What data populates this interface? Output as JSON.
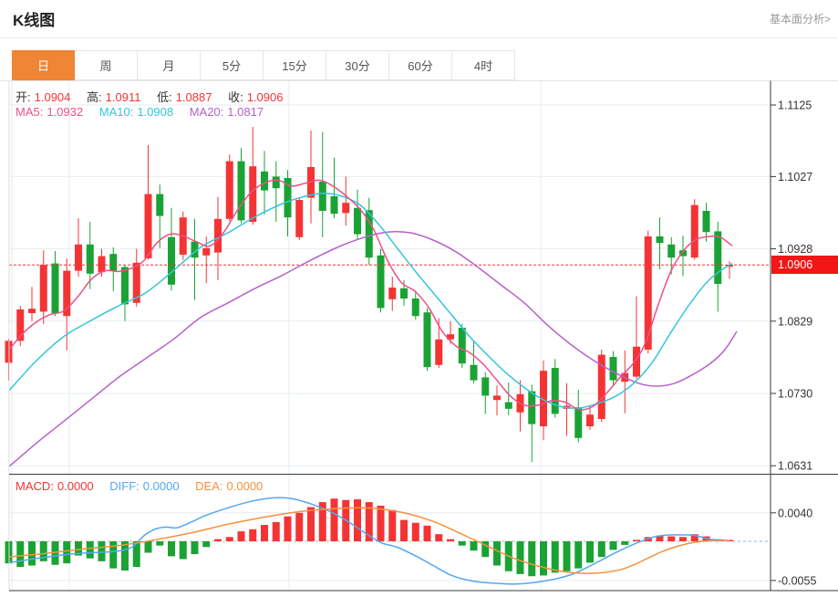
{
  "header": {
    "title": "K线图",
    "link_label": "基本面分析>"
  },
  "tabs": {
    "items": [
      "日",
      "周",
      "月",
      "5分",
      "15分",
      "30分",
      "60分",
      "4时"
    ],
    "active": "日"
  },
  "ohlc": {
    "o_label": "开:",
    "o": "1.0904",
    "h_label": "高:",
    "h": "1.0911",
    "l_label": "低:",
    "l": "1.0887",
    "c_label": "收:",
    "c": "1.0906"
  },
  "ma": {
    "ma5_label": "MA5:",
    "ma5": "1.0932",
    "ma10_label": "MA10:",
    "ma10": "1.0908",
    "ma20_label": "MA20:",
    "ma20": "1.0817"
  },
  "macd_readout": {
    "macd_label": "MACD:",
    "macd": "0.0000",
    "diff_label": "DIFF:",
    "diff": "0.0000",
    "dea_label": "DEA:",
    "dea": "0.0000"
  },
  "price_tag": "1.0906",
  "colors": {
    "up": "#f43434",
    "down": "#1aa334",
    "ma5": "#ee5087",
    "ma10": "#35c5dc",
    "ma20": "#b662c9",
    "diff": "#55a7f0",
    "dea": "#f5913d",
    "tab_active": "#ef8535",
    "tag_bg": "#f21616",
    "axis_text": "#333333",
    "grid": "#e6edf3",
    "frame": "#3a3a3a",
    "light_border": "#dddddd"
  },
  "chart_data": {
    "type": "candlestick+macd",
    "title": "K线图",
    "price_axis_ticks": [
      1.1125,
      1.1027,
      1.0928,
      1.0829,
      1.073,
      1.0631
    ],
    "macd_axis_ticks": [
      0.004,
      -0.0055
    ],
    "last_price": 1.0906,
    "grid_x": [
      13,
      76,
      317,
      593
    ],
    "candles": [
      [
        1.0772,
        1.0805,
        1.0748,
        1.0802
      ],
      [
        1.0802,
        1.085,
        1.0795,
        1.0845
      ],
      [
        1.084,
        1.0876,
        1.0829,
        1.0846
      ],
      [
        1.0842,
        1.0926,
        1.0825,
        1.0906
      ],
      [
        1.0908,
        1.0925,
        1.0836,
        1.084
      ],
      [
        1.0836,
        1.0915,
        1.0789,
        1.0898
      ],
      [
        1.0898,
        1.097,
        1.089,
        1.0934
      ],
      [
        1.0934,
        1.0965,
        1.0873,
        1.0894
      ],
      [
        1.0896,
        1.0928,
        1.089,
        1.0918
      ],
      [
        1.0921,
        1.093,
        1.087,
        1.0898
      ],
      [
        1.0903,
        1.0906,
        1.0829,
        1.0852
      ],
      [
        1.0854,
        1.0928,
        1.0849,
        1.0909
      ],
      [
        1.0915,
        1.107,
        1.0913,
        1.1003
      ],
      [
        1.1003,
        1.1016,
        1.0929,
        1.0973
      ],
      [
        1.0944,
        1.0984,
        1.0871,
        1.0879
      ],
      [
        1.092,
        1.0979,
        1.0913,
        1.0971
      ],
      [
        1.0938,
        1.0969,
        1.0858,
        1.0916
      ],
      [
        1.0919,
        1.0945,
        1.0881,
        1.0929
      ],
      [
        1.0923,
        1.0999,
        1.0885,
        1.0969
      ],
      [
        1.0969,
        1.1057,
        1.0966,
        1.1048
      ],
      [
        1.1048,
        1.1066,
        1.0963,
        1.0967
      ],
      [
        1.0965,
        1.1095,
        1.0961,
        1.1041
      ],
      [
        1.1034,
        1.1062,
        1.0975,
        1.1008
      ],
      [
        1.1027,
        1.1048,
        1.0965,
        1.1011
      ],
      [
        1.1025,
        1.1036,
        1.0945,
        1.0971
      ],
      [
        1.0944,
        1.0998,
        1.094,
        1.0995
      ],
      [
        1.0998,
        1.109,
        1.0963,
        1.104
      ],
      [
        1.102,
        1.1088,
        1.0944,
        1.098
      ],
      [
        1.1,
        1.1053,
        1.097,
        1.0976
      ],
      [
        1.0977,
        1.1027,
        1.096,
        1.0991
      ],
      [
        1.0984,
        1.1009,
        1.094,
        1.0948
      ],
      [
        1.0981,
        1.0998,
        1.0906,
        1.0916
      ],
      [
        1.0919,
        1.0928,
        1.0841,
        1.0847
      ],
      [
        1.0859,
        1.089,
        1.0843,
        1.0875
      ],
      [
        1.0874,
        1.0885,
        1.085,
        1.086
      ],
      [
        1.086,
        1.0871,
        1.0831,
        1.0836
      ],
      [
        1.0841,
        1.0847,
        1.0761,
        1.0766
      ],
      [
        1.0769,
        1.0833,
        1.0765,
        1.0804
      ],
      [
        1.0804,
        1.0829,
        1.0798,
        1.0811
      ],
      [
        1.082,
        1.0825,
        1.0765,
        1.0771
      ],
      [
        1.0769,
        1.0801,
        1.0744,
        1.0748
      ],
      [
        1.0752,
        1.0759,
        1.0702,
        1.0727
      ],
      [
        1.0721,
        1.0741,
        1.07,
        1.0727
      ],
      [
        1.0718,
        1.0745,
        1.07,
        1.0709
      ],
      [
        1.0704,
        1.0748,
        1.0678,
        1.0729
      ],
      [
        1.0733,
        1.0742,
        1.0636,
        1.0688
      ],
      [
        1.0685,
        1.0775,
        1.0666,
        1.0761
      ],
      [
        1.0765,
        1.0777,
        1.0697,
        1.0702
      ],
      [
        1.0709,
        1.0744,
        1.0672,
        1.0713
      ],
      [
        1.0711,
        1.0735,
        1.0663,
        1.0669
      ],
      [
        1.0685,
        1.0713,
        1.068,
        1.0701
      ],
      [
        1.0695,
        1.079,
        1.0691,
        1.0783
      ],
      [
        1.078,
        1.0788,
        1.0741,
        1.0748
      ],
      [
        1.0746,
        1.0789,
        1.0703,
        1.0758
      ],
      [
        1.0753,
        1.0863,
        1.075,
        1.0794
      ],
      [
        1.079,
        1.0953,
        1.0785,
        1.0945
      ],
      [
        1.0945,
        1.0971,
        1.09,
        1.0936
      ],
      [
        1.0934,
        1.0944,
        1.0893,
        1.0916
      ],
      [
        1.0926,
        1.0946,
        1.0891,
        1.0918
      ],
      [
        1.0916,
        1.0996,
        1.0913,
        1.0988
      ],
      [
        1.098,
        1.0991,
        1.0938,
        1.0951
      ],
      [
        1.0952,
        1.0965,
        1.0842,
        1.088
      ],
      [
        1.0904,
        1.0911,
        1.0887,
        1.0906
      ]
    ],
    "ma5_points": [
      [
        10,
        1.079
      ],
      [
        25,
        1.0812
      ],
      [
        40,
        1.0828
      ],
      [
        55,
        1.0838
      ],
      [
        70,
        1.0843
      ],
      [
        85,
        1.0862
      ],
      [
        100,
        1.0886
      ],
      [
        115,
        1.0898
      ],
      [
        130,
        1.0897
      ],
      [
        145,
        1.0902
      ],
      [
        158,
        1.0912
      ],
      [
        172,
        1.0936
      ],
      [
        186,
        1.0948
      ],
      [
        200,
        1.0946
      ],
      [
        215,
        1.0938
      ],
      [
        230,
        1.0932
      ],
      [
        245,
        1.095
      ],
      [
        260,
        1.098
      ],
      [
        275,
        1.1005
      ],
      [
        290,
        1.1018
      ],
      [
        305,
        1.1022
      ],
      [
        320,
        1.1014
      ],
      [
        335,
        1.1018
      ],
      [
        350,
        1.1022
      ],
      [
        365,
        1.1014
      ],
      [
        380,
        1.1
      ],
      [
        395,
        1.0982
      ],
      [
        410,
        1.0954
      ],
      [
        425,
        1.0912
      ],
      [
        440,
        1.0882
      ],
      [
        455,
        1.087
      ],
      [
        470,
        1.0848
      ],
      [
        485,
        1.0815
      ],
      [
        500,
        1.0795
      ],
      [
        515,
        1.0786
      ],
      [
        530,
        1.077
      ],
      [
        545,
        1.0748
      ],
      [
        560,
        1.0726
      ],
      [
        575,
        1.0714
      ],
      [
        590,
        1.0714
      ],
      [
        605,
        1.072
      ],
      [
        620,
        1.0718
      ],
      [
        635,
        1.0708
      ],
      [
        650,
        1.0712
      ],
      [
        665,
        1.073
      ],
      [
        680,
        1.0752
      ],
      [
        695,
        1.0772
      ],
      [
        708,
        1.08
      ],
      [
        722,
        1.0852
      ],
      [
        736,
        1.0898
      ],
      [
        750,
        1.0926
      ],
      [
        764,
        1.0941
      ],
      [
        778,
        1.0945
      ],
      [
        790,
        1.0944
      ],
      [
        803,
        1.0932
      ]
    ],
    "ma10_points": [
      [
        10,
        1.0734
      ],
      [
        40,
        1.0775
      ],
      [
        70,
        1.0808
      ],
      [
        100,
        1.083
      ],
      [
        130,
        1.085
      ],
      [
        160,
        1.0868
      ],
      [
        190,
        1.0898
      ],
      [
        220,
        1.093
      ],
      [
        250,
        1.095
      ],
      [
        280,
        1.0972
      ],
      [
        310,
        1.099
      ],
      [
        335,
        1.1
      ],
      [
        355,
        1.1004
      ],
      [
        375,
        1.1
      ],
      [
        395,
        1.0988
      ],
      [
        415,
        1.0962
      ],
      [
        435,
        1.093
      ],
      [
        455,
        1.0898
      ],
      [
        475,
        1.0868
      ],
      [
        495,
        1.0838
      ],
      [
        515,
        1.0808
      ],
      [
        535,
        1.0782
      ],
      [
        555,
        1.0758
      ],
      [
        575,
        1.0738
      ],
      [
        595,
        1.0722
      ],
      [
        615,
        1.0712
      ],
      [
        635,
        1.071
      ],
      [
        655,
        1.0716
      ],
      [
        675,
        1.0726
      ],
      [
        695,
        1.0744
      ],
      [
        715,
        1.0772
      ],
      [
        735,
        1.0812
      ],
      [
        755,
        1.085
      ],
      [
        775,
        1.0882
      ],
      [
        790,
        1.0898
      ],
      [
        803,
        1.0908
      ]
    ],
    "ma20_points": [
      [
        10,
        1.063
      ],
      [
        40,
        1.0662
      ],
      [
        70,
        1.0692
      ],
      [
        100,
        1.0722
      ],
      [
        130,
        1.0752
      ],
      [
        160,
        1.0778
      ],
      [
        190,
        1.0804
      ],
      [
        220,
        1.0834
      ],
      [
        250,
        1.0854
      ],
      [
        280,
        1.0874
      ],
      [
        310,
        1.0892
      ],
      [
        340,
        1.0912
      ],
      [
        370,
        1.093
      ],
      [
        400,
        1.0944
      ],
      [
        425,
        1.0951
      ],
      [
        450,
        1.095
      ],
      [
        475,
        1.094
      ],
      [
        500,
        1.0924
      ],
      [
        525,
        1.0902
      ],
      [
        550,
        1.0878
      ],
      [
        575,
        1.0854
      ],
      [
        600,
        1.0824
      ],
      [
        625,
        1.0798
      ],
      [
        650,
        1.0776
      ],
      [
        675,
        1.0758
      ],
      [
        700,
        1.0744
      ],
      [
        720,
        1.074
      ],
      [
        740,
        1.0744
      ],
      [
        760,
        1.0756
      ],
      [
        780,
        1.0772
      ],
      [
        795,
        1.079
      ],
      [
        808,
        1.0815
      ]
    ],
    "macd_hist": [
      -0.0031,
      -0.0036,
      -0.0034,
      -0.0028,
      -0.0033,
      -0.0031,
      -0.002,
      -0.0024,
      -0.0028,
      -0.0038,
      -0.0041,
      -0.0036,
      -0.0016,
      -0.0006,
      -0.0021,
      -0.0025,
      -0.0018,
      -0.0008,
      0.0003,
      0.0006,
      0.0014,
      0.0017,
      0.0023,
      0.0027,
      0.0035,
      0.004,
      0.0048,
      0.0055,
      0.006,
      0.0058,
      0.0059,
      0.0055,
      0.005,
      0.0044,
      0.003,
      0.0026,
      0.0022,
      0.001,
      0.0003,
      -0.0006,
      -0.0013,
      -0.0022,
      -0.0034,
      -0.0042,
      -0.0046,
      -0.0049,
      -0.0048,
      -0.0044,
      -0.0042,
      -0.0038,
      -0.003,
      -0.0022,
      -0.0012,
      -0.0005,
      0.0002,
      0.0006,
      0.0008,
      0.0007,
      0.0006,
      0.001,
      0.0007,
      0.0003,
      0.0002
    ],
    "diff_points": [
      [
        10,
        -0.003
      ],
      [
        40,
        -0.0024
      ],
      [
        70,
        -0.0019
      ],
      [
        100,
        -0.0016
      ],
      [
        128,
        -0.0014
      ],
      [
        145,
        -0.0008
      ],
      [
        158,
        0.0008
      ],
      [
        170,
        0.0017
      ],
      [
        182,
        0.002
      ],
      [
        194,
        0.0019
      ],
      [
        208,
        0.0026
      ],
      [
        225,
        0.0036
      ],
      [
        250,
        0.0047
      ],
      [
        275,
        0.0056
      ],
      [
        300,
        0.0061
      ],
      [
        320,
        0.006
      ],
      [
        340,
        0.0053
      ],
      [
        360,
        0.0043
      ],
      [
        380,
        0.0029
      ],
      [
        400,
        0.0012
      ],
      [
        418,
        -0.0002
      ],
      [
        435,
        -0.0008
      ],
      [
        455,
        -0.002
      ],
      [
        475,
        -0.0034
      ],
      [
        492,
        -0.0046
      ],
      [
        508,
        -0.0053
      ],
      [
        525,
        -0.0057
      ],
      [
        545,
        -0.0059
      ],
      [
        565,
        -0.006
      ],
      [
        585,
        -0.0058
      ],
      [
        600,
        -0.0055
      ],
      [
        612,
        -0.0052
      ],
      [
        628,
        -0.0046
      ],
      [
        645,
        -0.0036
      ],
      [
        660,
        -0.0026
      ],
      [
        675,
        -0.0016
      ],
      [
        690,
        -0.0007
      ],
      [
        705,
        0.0001
      ],
      [
        720,
        0.0007
      ],
      [
        735,
        0.0009
      ],
      [
        750,
        0.0009
      ],
      [
        763,
        0.0008
      ],
      [
        778,
        0.0003
      ],
      [
        790,
        0.0002
      ],
      [
        800,
        0.0001
      ]
    ],
    "dea_points": [
      [
        10,
        -0.0022
      ],
      [
        50,
        -0.0017
      ],
      [
        90,
        -0.0011
      ],
      [
        130,
        -0.0006
      ],
      [
        170,
        0.0002
      ],
      [
        210,
        0.0012
      ],
      [
        250,
        0.0024
      ],
      [
        290,
        0.0034
      ],
      [
        330,
        0.0042
      ],
      [
        370,
        0.0046
      ],
      [
        400,
        0.0047
      ],
      [
        425,
        0.0044
      ],
      [
        450,
        0.0038
      ],
      [
        475,
        0.0028
      ],
      [
        500,
        0.0014
      ],
      [
        520,
        0.0002
      ],
      [
        540,
        -0.001
      ],
      [
        560,
        -0.0022
      ],
      [
        580,
        -0.0031
      ],
      [
        600,
        -0.0038
      ],
      [
        620,
        -0.0043
      ],
      [
        640,
        -0.0045
      ],
      [
        660,
        -0.0044
      ],
      [
        680,
        -0.004
      ],
      [
        695,
        -0.0033
      ],
      [
        710,
        -0.0024
      ],
      [
        725,
        -0.0015
      ],
      [
        740,
        -0.0008
      ],
      [
        755,
        -0.0003
      ],
      [
        770,
        0.0
      ],
      [
        785,
        0.0001
      ],
      [
        800,
        0.0001
      ]
    ]
  }
}
